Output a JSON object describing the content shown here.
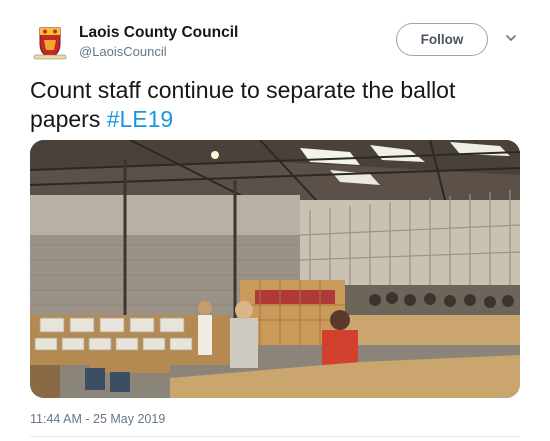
{
  "account": {
    "display_name": "Laois County Council",
    "handle": "@LaoisCouncil"
  },
  "header": {
    "follow_label": "Follow",
    "more_icon": "chevron-down-icon"
  },
  "tweet": {
    "text": "Count staff continue to separate the ballot papers ",
    "hashtag": "#LE19"
  },
  "meta": {
    "timestamp": "11:44 AM - 25 May 2019"
  },
  "colors": {
    "hashtag": "#1b95e0",
    "secondary_text": "#657786",
    "primary_text": "#14171a"
  }
}
